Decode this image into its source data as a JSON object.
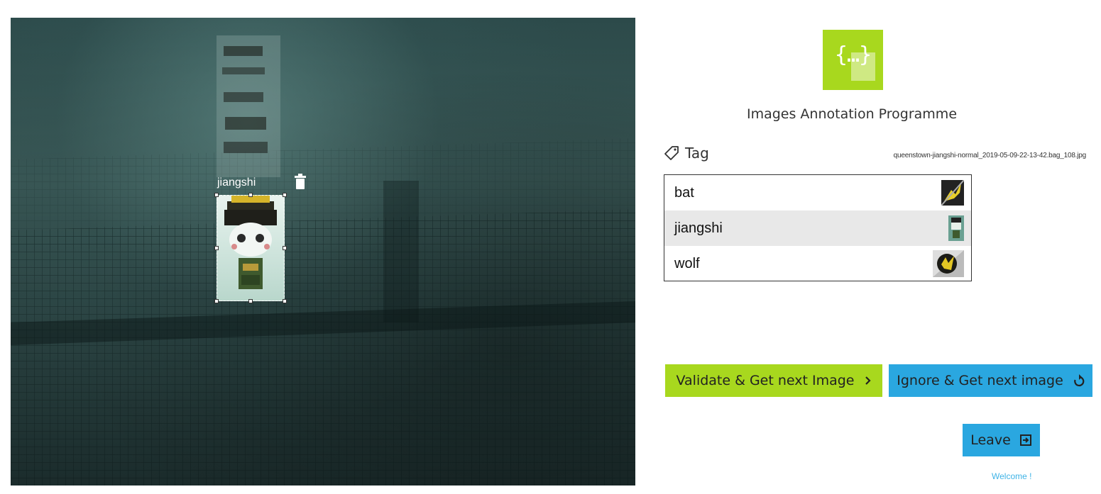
{
  "canvas": {
    "annotation": {
      "label": "jiangshi"
    }
  },
  "app": {
    "title": "Images Annotation Programme",
    "logo_icon": "curly-braces-logo"
  },
  "tag_panel": {
    "header": "Tag",
    "filename": "queenstown-jiangshi-normal_2019-05-09-22-13-42.bag_108.jpg",
    "items": [
      {
        "label": "bat",
        "selected": false
      },
      {
        "label": "jiangshi",
        "selected": true
      },
      {
        "label": "wolf",
        "selected": false
      }
    ]
  },
  "buttons": {
    "validate": "Validate & Get next Image",
    "ignore": "Ignore & Get next image",
    "leave": "Leave"
  },
  "footer": {
    "welcome": "Welcome !"
  },
  "colors": {
    "accent_green": "#a8d81e",
    "accent_blue": "#2aa7e0",
    "link_blue": "#3fb3e6"
  }
}
